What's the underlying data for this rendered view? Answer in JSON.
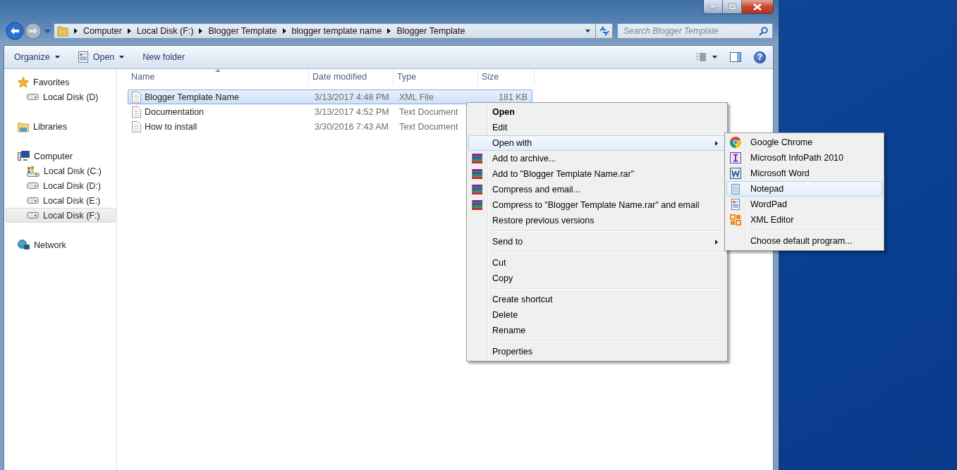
{
  "address_bar": {
    "breadcrumbs": [
      "Computer",
      "Local Disk (F:)",
      "Blogger Template",
      "blogger template name",
      "Blogger Template"
    ]
  },
  "search": {
    "placeholder": "Search Blogger Template"
  },
  "toolbar": {
    "buttons": [
      {
        "label": "Organize",
        "dropdown": true,
        "kind": "plain"
      },
      {
        "label": "Open",
        "dropdown": true,
        "kind": "open"
      },
      {
        "label": "New folder",
        "dropdown": false,
        "kind": "plain"
      }
    ],
    "help_label": "?"
  },
  "sidebar": {
    "groups": [
      {
        "kind": "favorites",
        "label": "Favorites",
        "selected": false,
        "children": [
          {
            "kind": "drive",
            "label": "Local Disk (D)",
            "selected": false
          }
        ]
      },
      {
        "kind": "libraries",
        "label": "Libraries",
        "selected": false
      },
      {
        "kind": "computer",
        "label": "Computer",
        "selected": false,
        "children": [
          {
            "kind": "system-drive",
            "label": "Local Disk (C:)",
            "selected": false
          },
          {
            "kind": "drive",
            "label": "Local Disk (D:)",
            "selected": false
          },
          {
            "kind": "drive",
            "label": "Local Disk (E:)",
            "selected": false
          },
          {
            "kind": "drive",
            "label": "Local Disk (F:)",
            "selected": true
          }
        ]
      },
      {
        "kind": "network",
        "label": "Network",
        "selected": false
      }
    ]
  },
  "file_list": {
    "columns": [
      {
        "label": "Name",
        "sorted": true
      },
      {
        "label": "Date modified",
        "sorted": false
      },
      {
        "label": "Type",
        "sorted": false
      },
      {
        "label": "Size",
        "sorted": false
      }
    ],
    "rows": [
      {
        "name": "Blogger Template Name",
        "date": "3/13/2017 4:48 PM",
        "type": "XML File",
        "size": "181 KB",
        "selected": true
      },
      {
        "name": "Documentation",
        "date": "3/13/2017 4:52 PM",
        "type": "Text Document",
        "selected": false
      },
      {
        "name": "How to install",
        "date": "3/30/2016 7:43 AM",
        "type": "Text Document",
        "selected": false
      }
    ]
  },
  "context_menu": {
    "items": [
      {
        "kind": "command",
        "label": "Open",
        "default": true,
        "selected": false
      },
      {
        "kind": "command",
        "label": "Edit",
        "default": false,
        "selected": false
      },
      {
        "kind": "submenu",
        "label": "Open with",
        "default": false,
        "selected": true
      },
      {
        "kind": "archiver",
        "label": "Add to archive...",
        "default": false,
        "selected": false
      },
      {
        "kind": "archiver",
        "label": "Add to \"Blogger Template Name.rar\"",
        "default": false,
        "selected": false
      },
      {
        "kind": "archiver",
        "label": "Compress and email...",
        "default": false,
        "selected": false
      },
      {
        "kind": "archiver",
        "label": "Compress to \"Blogger Template Name.rar\" and email",
        "default": false,
        "selected": false
      },
      {
        "kind": "command",
        "label": "Restore previous versions",
        "default": false,
        "selected": false
      },
      {
        "kind": "separator"
      },
      {
        "kind": "submenu",
        "label": "Send to",
        "default": false,
        "selected": false
      },
      {
        "kind": "separator"
      },
      {
        "kind": "command",
        "label": "Cut",
        "default": false,
        "selected": false
      },
      {
        "kind": "command",
        "label": "Copy",
        "default": false,
        "selected": false
      },
      {
        "kind": "separator"
      },
      {
        "kind": "command",
        "label": "Create shortcut",
        "default": false,
        "selected": false
      },
      {
        "kind": "command",
        "label": "Delete",
        "default": false,
        "selected": false
      },
      {
        "kind": "command",
        "label": "Rename",
        "default": false,
        "selected": false
      },
      {
        "kind": "separator"
      },
      {
        "kind": "command",
        "label": "Properties",
        "default": false,
        "selected": false
      }
    ]
  },
  "open_with_menu": {
    "items": [
      {
        "kind": "app",
        "label": "Google Chrome",
        "selected": false
      },
      {
        "kind": "app",
        "label": "Microsoft InfoPath 2010",
        "selected": false
      },
      {
        "kind": "app",
        "label": "Microsoft Word",
        "selected": false
      },
      {
        "kind": "app",
        "label": "Notepad",
        "selected": true
      },
      {
        "kind": "app",
        "label": "WordPad",
        "selected": false
      },
      {
        "kind": "app",
        "label": "XML Editor",
        "selected": false
      },
      {
        "kind": "separator"
      },
      {
        "kind": "command",
        "label": "Choose default program...",
        "selected": false
      }
    ]
  }
}
